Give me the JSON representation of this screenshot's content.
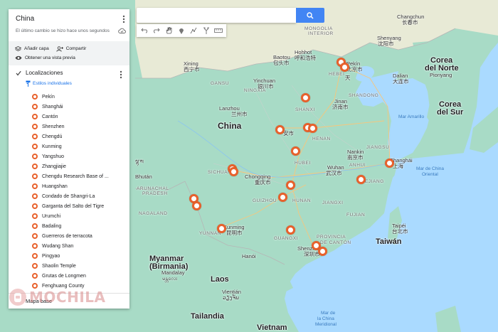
{
  "panel": {
    "title": "China",
    "last_change": "El último cambio se hizo hace unos segundos",
    "add_layer": "Añadir capa",
    "share": "Compartir",
    "preview": "Obtener una vista previa",
    "layer_title": "Localizaciones",
    "styles_link": "Estilos individuales",
    "basemap": "Mapa base",
    "places": [
      "Pekín",
      "Shanghái",
      "Cantón",
      "Shenzhen",
      "Chengdú",
      "Kunming",
      "Yangshuo",
      "Zhangjiajie",
      "Chengdu Research Base of ...",
      "Huangshan",
      "Condado de Shangri-La",
      "Garganta del Salto del Tigre",
      "Urumchi",
      "Badaling",
      "Guerreros de terracota",
      "Wudang Shan",
      "Pingyao",
      "Shaolin Temple",
      "Grutas de Longmen",
      "Fenghuang County"
    ]
  },
  "search": {
    "placeholder": ""
  },
  "map_labels": {
    "china": "China",
    "mongolia_en": "MONGOLIA",
    "mongolia_sub": "INTERIOR",
    "hebei": "HEBEI",
    "beijing": "Pekín",
    "beijing_cn": "北京市",
    "shanxi": "SHANXI",
    "shandong": "SHANDONG",
    "jinan": "Jinan",
    "jinan_cn": "济南市",
    "henan": "HENAN",
    "jiangsu": "JIANGSU",
    "nanjing": "Nankin",
    "nanjing_cn": "南京市",
    "shanghai": "Shanghái",
    "shanghai_cn": "上海",
    "hubei": "HUBEI",
    "wuhan": "Wuhan",
    "wuhan_cn": "武汉市",
    "zhejiang": "ZHEJIANG",
    "anhui": "ANHUI",
    "jiangxi": "JIANGXI",
    "hunan": "HUNAN",
    "fujian": "FUJIAN",
    "chongqing": "Chongqing",
    "chongqing_cn": "重庆市",
    "guizhou": "GUIZHOU",
    "sichuan": "SICHUAN",
    "yunnan": "YUNNAN",
    "kunming": "Kunming",
    "kunming_cn": "昆明市",
    "guangxi": "GUANGXI",
    "guangdong1": "PROVINCIA",
    "guangdong2": "DE CANTÓN",
    "shenzhen": "Shenzhen",
    "shenzhen_cn": "深圳市",
    "lanzhou": "Lanzhou",
    "lanzhou_cn": "兰州市",
    "xian_cn": "安市",
    "gansu": "GANSU",
    "ningxia": "NINGXIA",
    "yinchuan": "Yinchuan",
    "yinchuan_cn": "银川市",
    "baotou": "Baotou",
    "baotou_cn": "包头市",
    "hohhot": "Hohhot",
    "hohhot_cn": "呼和浩特",
    "xining": "Xining",
    "xining_cn": "西宁市",
    "changchun": "Changchun",
    "changchun_cn": "长春市",
    "shenyang": "Shenyang",
    "shenyang_cn": "沈阳市",
    "dalian": "Dalian",
    "dalian_cn": "大连市",
    "tianjin_cn": "天",
    "nkorea1": "Corea",
    "nkorea2": "del Norte",
    "pyongyang": "Pionyang",
    "skorea1": "Corea",
    "skorea2": "del Sur",
    "yellow_sea": "Mar Amarillo",
    "ecs1": "Mar de China",
    "ecs2": "Oriental",
    "taipei": "Taipéi",
    "taipei_cn": "台北市",
    "taiwan": "Taiwán",
    "myanmar1": "Myanmar",
    "myanmar2": "(Birmania)",
    "mandalay": "Mandalay",
    "mandalay_my": "မန္တလေး",
    "laos": "Laos",
    "hanoi": "Hanói",
    "vientiane": "Vientián",
    "vientiane_lo": "ວຽງຈັນ",
    "thailand": "Tailandia",
    "vietnam": "Vietnam",
    "scs1": "Mar de",
    "scs2": "la China",
    "scs3": "Meridional",
    "arunachal1": "ARUNACHAL",
    "arunachal2": "PRADESH",
    "nagaland": "NAGALAND",
    "bhutan": "Bhután",
    "lhasa": "ལྷ་ས"
  },
  "watermark": "MOCHILA",
  "colors": {
    "accent": "#e8612c",
    "search_button": "#4285f4",
    "land": "#9fd8c6",
    "water": "#aadaff"
  }
}
